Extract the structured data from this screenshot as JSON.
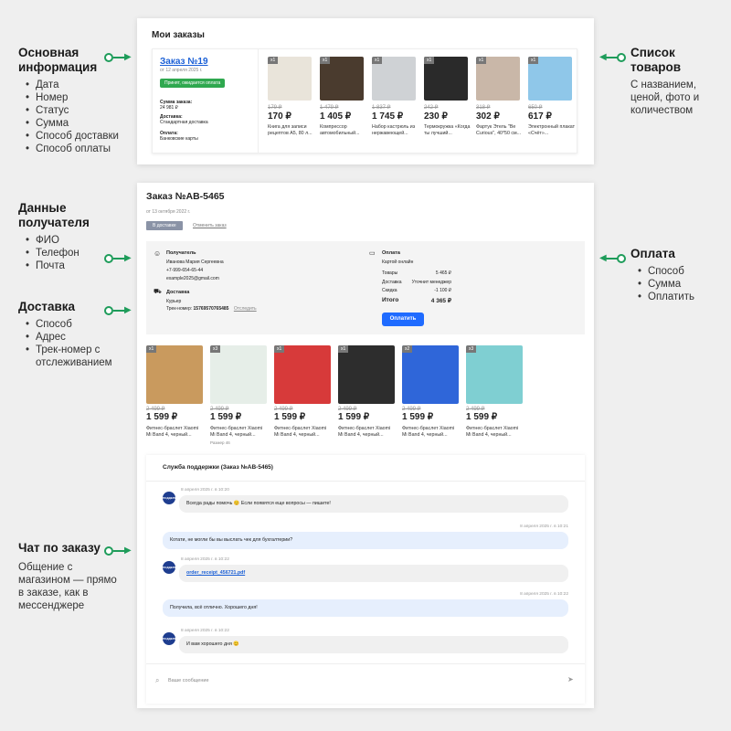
{
  "annotations": {
    "basic": {
      "title": "Основная информация",
      "items": [
        "Дата",
        "Номер",
        "Статус",
        "Сумма",
        "Способ доставки",
        "Способ оплаты"
      ]
    },
    "goods": {
      "title": "Список товаров",
      "text": "С названием, ценой, фото и количеством"
    },
    "recipient": {
      "title": "Данные получателя",
      "items": [
        "ФИО",
        "Телефон",
        "Почта"
      ]
    },
    "delivery": {
      "title": "Доставка",
      "items": [
        "Способ",
        "Адрес",
        "Трек-номер с отслеживанием"
      ]
    },
    "payment": {
      "title": "Оплата",
      "items": [
        "Способ",
        "Сумма",
        "Оплатить"
      ]
    },
    "chat": {
      "title": "Чат по заказу",
      "text": "Общение с магазином — прямо в заказе, как в мессенджере"
    }
  },
  "orders": {
    "title": "Мои заказы",
    "order_link": "Заказ №19",
    "date": "от 12 апреля 2025 г.",
    "status": "Принят, ожидается оплата",
    "sum_label": "Сумма заказа:",
    "sum_value": "24 981 ₽",
    "delivery_label": "Доставка:",
    "delivery_value": "Стандартная доставка",
    "payment_label": "Оплата:",
    "payment_value": "Банковские карты",
    "items": [
      {
        "qty": "x1",
        "old": "179 ₽",
        "price": "170 ₽",
        "name": "Книга для записи рецептов А5, 80 л...",
        "color": "#e9e4da"
      },
      {
        "qty": "x1",
        "old": "1 479 ₽",
        "price": "1 405 ₽",
        "name": "Компрессор автомобильный...",
        "color": "#4a3b2e"
      },
      {
        "qty": "x1",
        "old": "1 837 ₽",
        "price": "1 745 ₽",
        "name": "Набор кастрюль из нержавеющей...",
        "color": "#cfd2d5"
      },
      {
        "qty": "x1",
        "old": "242 ₽",
        "price": "230 ₽",
        "name": "Термокружка «Когда ты лучший...",
        "color": "#2a2a2a"
      },
      {
        "qty": "x1",
        "old": "318 ₽",
        "price": "302 ₽",
        "name": "Фартук Этель \"Be Curious\", 40*50 см...",
        "color": "#c9b7a8"
      },
      {
        "qty": "x1",
        "old": "650 ₽",
        "price": "617 ₽",
        "name": "Электронный плакат «Счёт»...",
        "color": "#8fc7e9"
      }
    ]
  },
  "detail": {
    "title": "Заказ №АВ-5465",
    "date": "от 13 октября 2022 г.",
    "status_btn": "В доставке",
    "cancel_link": "Отменить заказ",
    "recipient": {
      "heading": "Получатель",
      "name": "Иванова Мария Сергеевна",
      "phone": "+7-999-654-65-44",
      "email": "example2025@gmail.com"
    },
    "delivery": {
      "heading": "Доставка",
      "method": "Курьер",
      "track_label": "Трек-номер:",
      "track": "15769570765485",
      "track_link": "Отследить"
    },
    "payment": {
      "heading": "Оплата",
      "method": "Картой онлайн",
      "rows": [
        {
          "label": "Товары",
          "value": "5 465 ₽"
        },
        {
          "label": "Доставка",
          "value": "Уточнит менеджер"
        },
        {
          "label": "Скидка",
          "value": "-1 100 ₽"
        }
      ],
      "total_label": "Итого",
      "total_value": "4 365 ₽",
      "pay_button": "Оплатить"
    },
    "items": [
      {
        "qty": "x1",
        "old": "2 499 ₽",
        "price": "1 599 ₽",
        "name": "Фитнес-браслет Xiaomi Mi Band 4, черный...",
        "extra": "",
        "color": "#c99a5e"
      },
      {
        "qty": "x3",
        "old": "2 499 ₽",
        "price": "1 599 ₽",
        "name": "Фитнес-браслет Xiaomi Mi Band 4, черный...",
        "extra": "Размер 46",
        "color": "#e6eee8"
      },
      {
        "qty": "x1",
        "old": "2 499 ₽",
        "price": "1 599 ₽",
        "name": "Фитнес-браслет Xiaomi Mi Band 4, черный...",
        "extra": "",
        "color": "#d73a3a"
      },
      {
        "qty": "x1",
        "old": "2 499 ₽",
        "price": "1 599 ₽",
        "name": "Фитнес-браслет Xiaomi Mi Band 4, черный...",
        "extra": "",
        "color": "#2d2d2d"
      },
      {
        "qty": "x2",
        "old": "2 499 ₽",
        "price": "1 599 ₽",
        "name": "Фитнес-браслет Xiaomi Mi Band 4, черный...",
        "extra": "",
        "color": "#2f66d9"
      },
      {
        "qty": "x3",
        "old": "2 499 ₽",
        "price": "1 599 ₽",
        "name": "Фитнес-браслет Xiaomi Mi Band 4, черный...",
        "extra": "",
        "color": "#7fcfd2"
      }
    ],
    "chat": {
      "title": "Служба поддержки (Заказ №АВ-5465)",
      "avatar_text": "ПОДДЕРЖКА",
      "messages": [
        {
          "from": "shop",
          "time": "8 апреля 2025 г. в 10:20",
          "text": "Всегда рады помочь 😊 Если появятся еще вопросы — пишите!"
        },
        {
          "from": "user",
          "time": "8 апреля 2025 г. в 10:21",
          "text": "Котати, не могли бы вы выслать чек для бухгалтерии?"
        },
        {
          "from": "shop",
          "time": "8 апреля 2025 г. в 10:22",
          "text": "order_receipt_456721.pdf"
        },
        {
          "from": "user",
          "time": "8 апреля 2025 г. в 10:22",
          "text": "Получила, всё отлично. Хорошего дня!"
        },
        {
          "from": "shop",
          "time": "8 апреля 2025 г. в 10:22",
          "text": "И вам хорошего дня 😊"
        }
      ],
      "input_placeholder": "Ваше сообщение"
    }
  },
  "colors": {
    "accent_green": "#1e9c5a",
    "link_blue": "#1a5fd6",
    "button_blue": "#1f6bff",
    "status_green": "#2fa84f"
  }
}
